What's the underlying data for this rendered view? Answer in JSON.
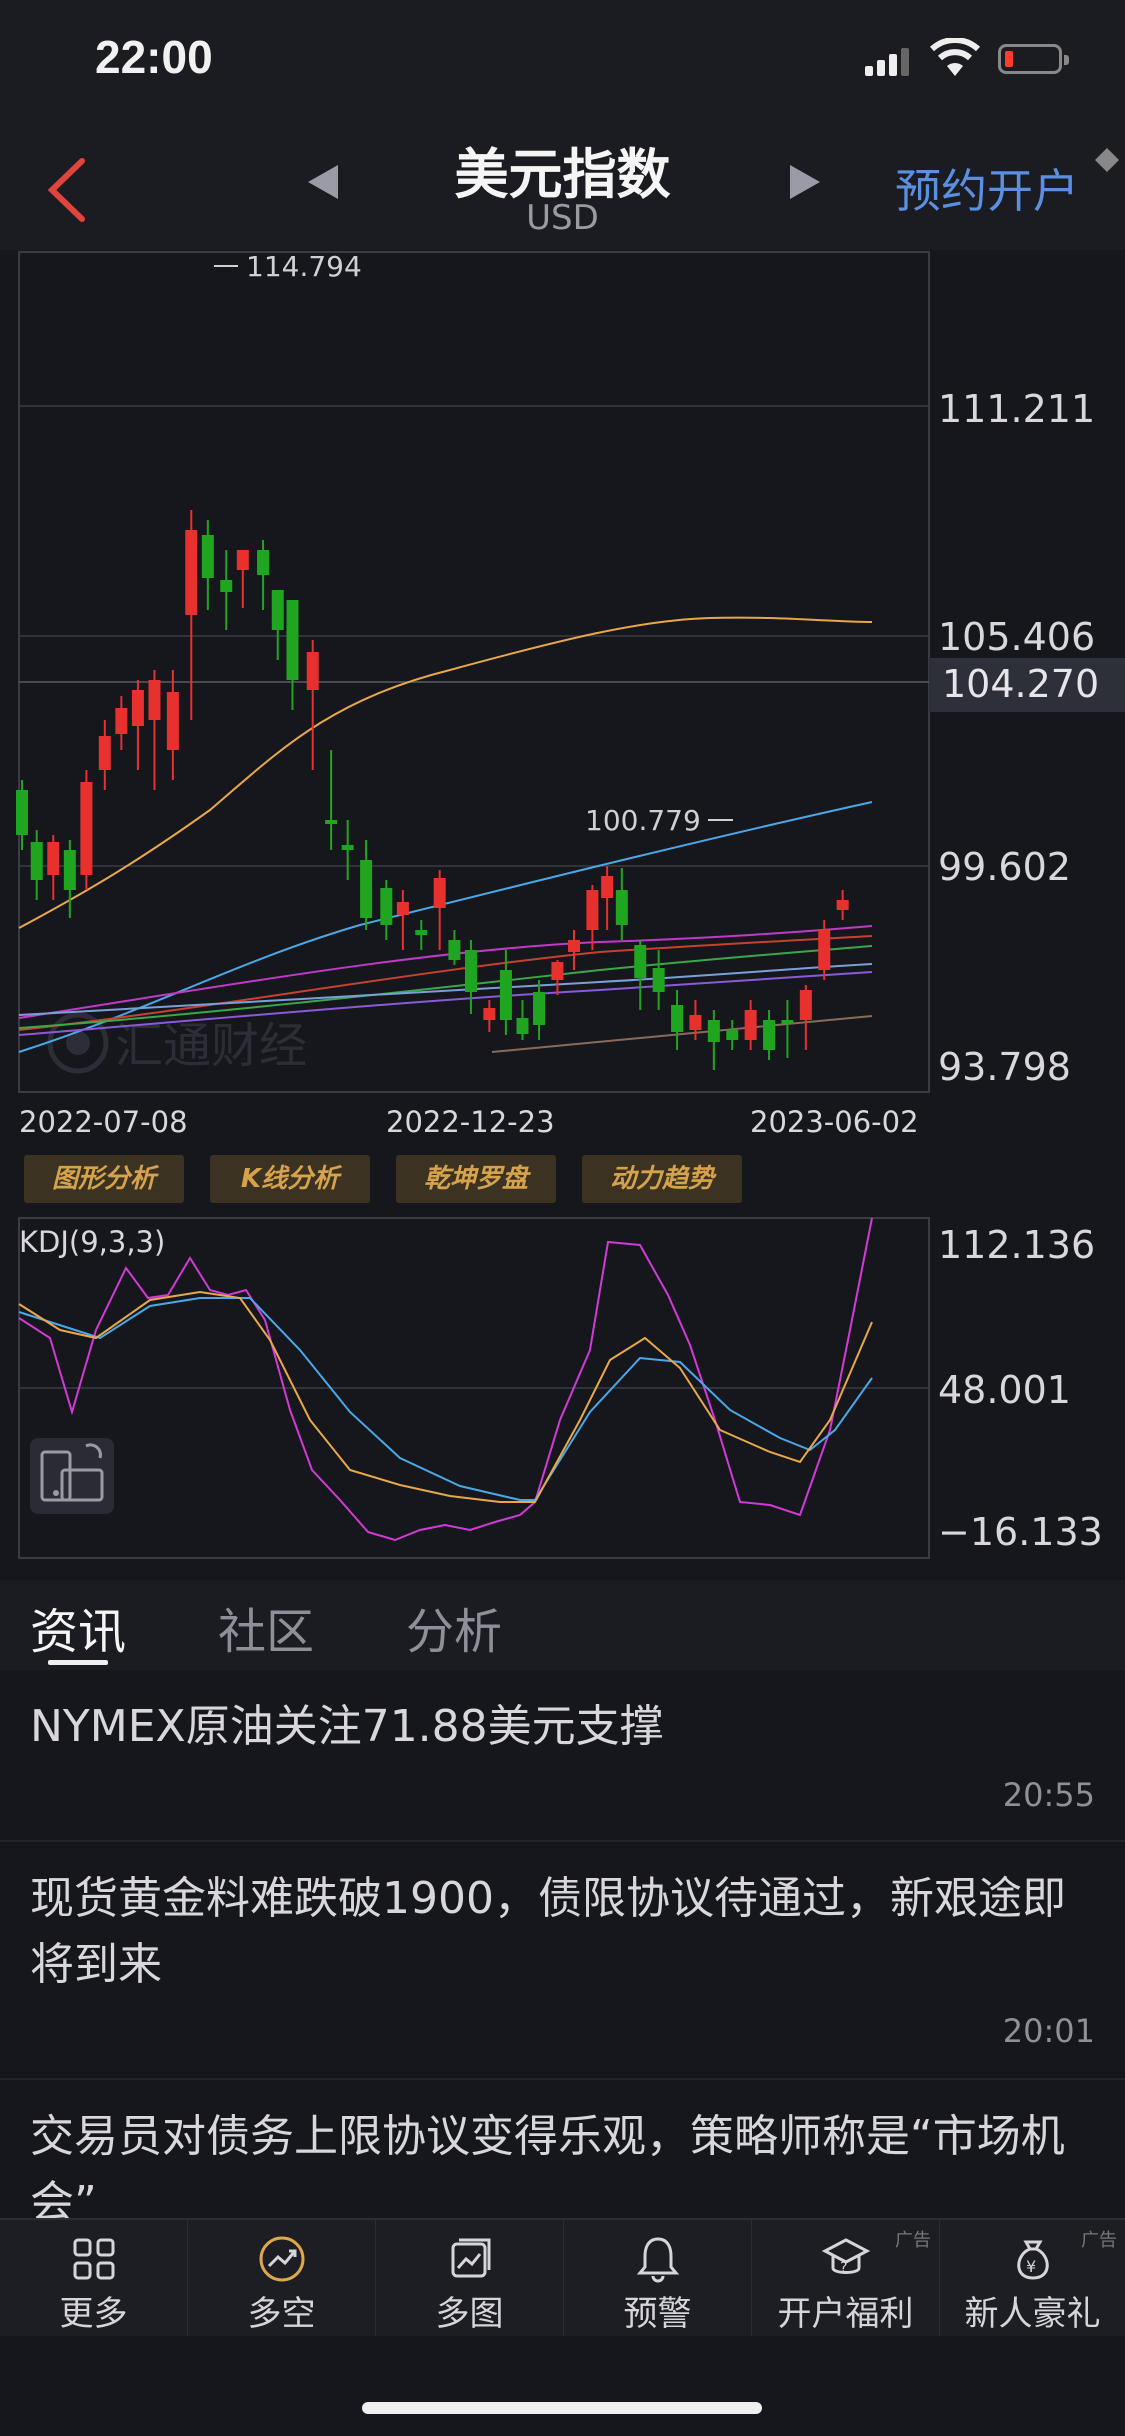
{
  "status_bar": {
    "time": "22:00"
  },
  "header": {
    "title": "美元指数",
    "subtitle": "USD",
    "reserve_label": "预约开户"
  },
  "price_chart": {
    "y_ticks": [
      "111.211",
      "105.406",
      "99.602",
      "93.798"
    ],
    "current_price": "104.270",
    "high_label": "114.794",
    "low_label": "100.779",
    "x_ticks": [
      "2022-07-08",
      "2022-12-23",
      "2023-06-02"
    ],
    "watermark": "汇通财经"
  },
  "analysis_tools": [
    "图形分析",
    "K线分析",
    "乾坤罗盘",
    "动力趋势"
  ],
  "kdj": {
    "label": "KDJ(9,3,3)",
    "y_ticks": [
      "112.136",
      "48.001",
      "−16.133"
    ]
  },
  "tabs": [
    "资讯",
    "社区",
    "分析"
  ],
  "news": [
    {
      "title": "NYMEX原油关注71.88美元支撑",
      "time": "20:55"
    },
    {
      "title": "现货黄金料难跌破1900，债限协议待通过，新艰途即将到来",
      "time": "20:01"
    },
    {
      "title": "交易员对债务上限协议变得乐观，策略师称是“市场机会”",
      "time": ""
    }
  ],
  "bottom_nav": [
    {
      "label": "更多",
      "icon": "grid-icon",
      "ad": ""
    },
    {
      "label": "多空",
      "icon": "trend-circle-icon",
      "ad": ""
    },
    {
      "label": "多图",
      "icon": "multi-chart-icon",
      "ad": ""
    },
    {
      "label": "预警",
      "icon": "bell-icon",
      "ad": ""
    },
    {
      "label": "开户福利",
      "icon": "graduation-cap-icon",
      "ad": "广告"
    },
    {
      "label": "新人豪礼",
      "icon": "money-bag-icon",
      "ad": "广告"
    }
  ],
  "colors": {
    "up": "#e8302f",
    "down": "#1fa51f",
    "accent": "#5b8fe0",
    "tool_text": "#d6a24b"
  }
}
